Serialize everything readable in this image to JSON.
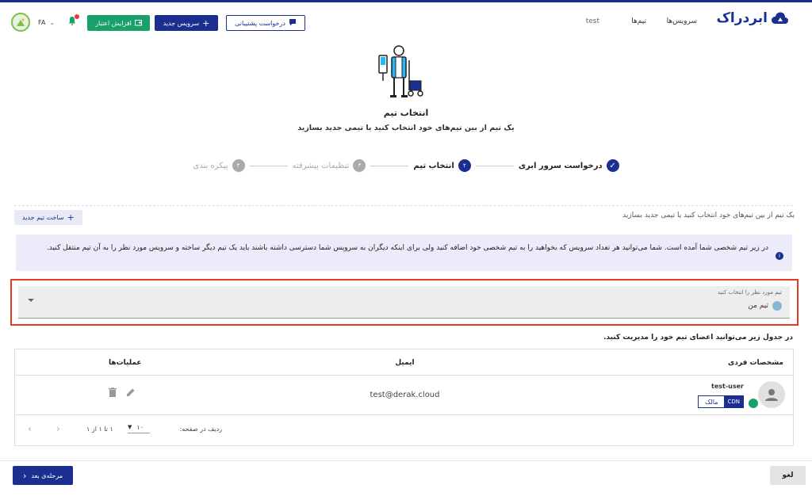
{
  "header": {
    "logo_text": "ابردراک",
    "nav": [
      "سرویس‌ها",
      "تیم‌ها",
      "test"
    ],
    "support_button": "درخواست پشتیبانی",
    "new_service_button": "سرویس جدید",
    "add_credit_button": "افزایش اعتبار",
    "lang": "FA"
  },
  "hero": {
    "title": "انتخاب تیم",
    "subtitle": "یک تیم از بین تیم‌های خود انتخاب کنید یا تیمی جدید بسازید"
  },
  "steps": [
    {
      "label": "درخواست سرور ابری",
      "marker": "✓",
      "state": "done"
    },
    {
      "label": "انتخاب تیم",
      "marker": "۲",
      "state": "active"
    },
    {
      "label": "تنظیمات پیشرفته",
      "marker": "۳",
      "state": "pending"
    },
    {
      "label": "پیکره بندی",
      "marker": "۴",
      "state": "pending"
    }
  ],
  "main": {
    "description": "یک تیم از بین تیم‌های خود انتخاب کنید یا تیمی جدید بسازید",
    "create_team_button": "ساخت تیم جدید",
    "info": "در زیر تیم شخصی شما آمده است. شما می‌توانید هر تعداد سرویس که بخواهید را به تیم شخصی خود اضافه کنید ولی برای اینکه دیگران به سرویس شما دسترسی داشته باشند باید یک تیم دیگر ساخته و سرویس مورد نظر را به آن تیم منتقل کنید.",
    "select_label": "تیم مورد نظر را انتخاب کنید",
    "select_value": "تیم من",
    "table_caption": "در جدول زیر می‌توانید اعضای تیم خود را مدیریت کنید."
  },
  "table": {
    "columns": [
      "مشخصات فردی",
      "ایمیل",
      "عملیات‌ها"
    ],
    "rows": [
      {
        "name": "test-user",
        "email": "test@derak.cloud",
        "badge_cdn": "CDN",
        "badge_role": "مالک"
      }
    ],
    "rows_per_page_label": "ردیف در صفحه:",
    "rows_per_page": "۱۰",
    "range": "۱ تا ۱ از ۱"
  },
  "footer": {
    "next_button": "مرحله‌ی بعد",
    "cancel_button": "لغو"
  },
  "colors": {
    "primary": "#1a2f8f",
    "green": "#1aa06a",
    "highlight": "#e53b25"
  }
}
